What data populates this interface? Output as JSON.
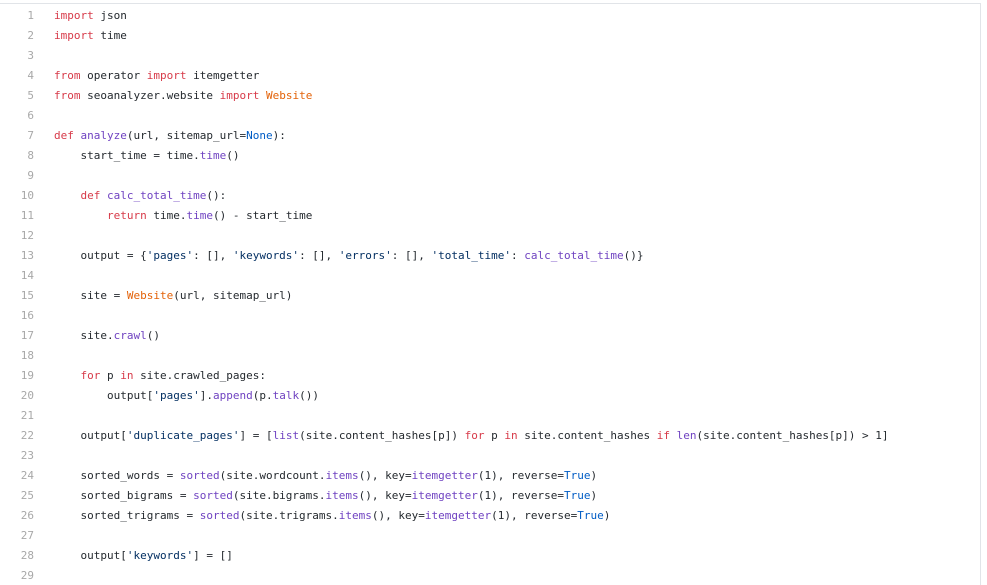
{
  "editor": {
    "lines": [
      {
        "number": "1",
        "tokens": [
          {
            "t": "import",
            "c": "kw"
          },
          {
            "t": " json",
            "c": "plain"
          }
        ]
      },
      {
        "number": "2",
        "tokens": [
          {
            "t": "import",
            "c": "kw"
          },
          {
            "t": " time",
            "c": "plain"
          }
        ]
      },
      {
        "number": "3",
        "tokens": []
      },
      {
        "number": "4",
        "tokens": [
          {
            "t": "from",
            "c": "kw"
          },
          {
            "t": " operator ",
            "c": "plain"
          },
          {
            "t": "import",
            "c": "kw"
          },
          {
            "t": " itemgetter",
            "c": "plain"
          }
        ]
      },
      {
        "number": "5",
        "tokens": [
          {
            "t": "from",
            "c": "kw"
          },
          {
            "t": " seoanalyzer.website ",
            "c": "plain"
          },
          {
            "t": "import",
            "c": "kw"
          },
          {
            "t": " ",
            "c": "plain"
          },
          {
            "t": "Website",
            "c": "cls"
          }
        ]
      },
      {
        "number": "6",
        "tokens": []
      },
      {
        "number": "7",
        "tokens": [
          {
            "t": "def",
            "c": "kw"
          },
          {
            "t": " ",
            "c": "plain"
          },
          {
            "t": "analyze",
            "c": "fn"
          },
          {
            "t": "(url, sitemap_url=",
            "c": "plain"
          },
          {
            "t": "None",
            "c": "const"
          },
          {
            "t": "):",
            "c": "plain"
          }
        ]
      },
      {
        "number": "8",
        "tokens": [
          {
            "t": "    start_time = time.",
            "c": "plain"
          },
          {
            "t": "time",
            "c": "fn"
          },
          {
            "t": "()",
            "c": "plain"
          }
        ]
      },
      {
        "number": "9",
        "tokens": []
      },
      {
        "number": "10",
        "tokens": [
          {
            "t": "    ",
            "c": "plain"
          },
          {
            "t": "def",
            "c": "kw"
          },
          {
            "t": " ",
            "c": "plain"
          },
          {
            "t": "calc_total_time",
            "c": "fn"
          },
          {
            "t": "():",
            "c": "plain"
          }
        ]
      },
      {
        "number": "11",
        "tokens": [
          {
            "t": "        ",
            "c": "plain"
          },
          {
            "t": "return",
            "c": "kw"
          },
          {
            "t": " time.",
            "c": "plain"
          },
          {
            "t": "time",
            "c": "fn"
          },
          {
            "t": "() - start_time",
            "c": "plain"
          }
        ]
      },
      {
        "number": "12",
        "tokens": []
      },
      {
        "number": "13",
        "tokens": [
          {
            "t": "    output = {",
            "c": "plain"
          },
          {
            "t": "'pages'",
            "c": "str"
          },
          {
            "t": ": [], ",
            "c": "plain"
          },
          {
            "t": "'keywords'",
            "c": "str"
          },
          {
            "t": ": [], ",
            "c": "plain"
          },
          {
            "t": "'errors'",
            "c": "str"
          },
          {
            "t": ": [], ",
            "c": "plain"
          },
          {
            "t": "'total_time'",
            "c": "str"
          },
          {
            "t": ": ",
            "c": "plain"
          },
          {
            "t": "calc_total_time",
            "c": "fn"
          },
          {
            "t": "()}",
            "c": "plain"
          }
        ]
      },
      {
        "number": "14",
        "tokens": []
      },
      {
        "number": "15",
        "tokens": [
          {
            "t": "    site = ",
            "c": "plain"
          },
          {
            "t": "Website",
            "c": "cls"
          },
          {
            "t": "(url, sitemap_url)",
            "c": "plain"
          }
        ]
      },
      {
        "number": "16",
        "tokens": []
      },
      {
        "number": "17",
        "tokens": [
          {
            "t": "    site.",
            "c": "plain"
          },
          {
            "t": "crawl",
            "c": "fn"
          },
          {
            "t": "()",
            "c": "plain"
          }
        ]
      },
      {
        "number": "18",
        "tokens": []
      },
      {
        "number": "19",
        "tokens": [
          {
            "t": "    ",
            "c": "plain"
          },
          {
            "t": "for",
            "c": "kw"
          },
          {
            "t": " p ",
            "c": "plain"
          },
          {
            "t": "in",
            "c": "kw"
          },
          {
            "t": " site.crawled_pages:",
            "c": "plain"
          }
        ]
      },
      {
        "number": "20",
        "tokens": [
          {
            "t": "        output[",
            "c": "plain"
          },
          {
            "t": "'pages'",
            "c": "str"
          },
          {
            "t": "].",
            "c": "plain"
          },
          {
            "t": "append",
            "c": "fn"
          },
          {
            "t": "(p.",
            "c": "plain"
          },
          {
            "t": "talk",
            "c": "fn"
          },
          {
            "t": "())",
            "c": "plain"
          }
        ]
      },
      {
        "number": "21",
        "tokens": []
      },
      {
        "number": "22",
        "tokens": [
          {
            "t": "    output[",
            "c": "plain"
          },
          {
            "t": "'duplicate_pages'",
            "c": "str"
          },
          {
            "t": "] = [",
            "c": "plain"
          },
          {
            "t": "list",
            "c": "fn"
          },
          {
            "t": "(site.content_hashes[p]) ",
            "c": "plain"
          },
          {
            "t": "for",
            "c": "kw"
          },
          {
            "t": " p ",
            "c": "plain"
          },
          {
            "t": "in",
            "c": "kw"
          },
          {
            "t": " site.content_hashes ",
            "c": "plain"
          },
          {
            "t": "if",
            "c": "kw"
          },
          {
            "t": " ",
            "c": "plain"
          },
          {
            "t": "len",
            "c": "fn"
          },
          {
            "t": "(site.content_hashes[p]) > 1]",
            "c": "plain"
          }
        ]
      },
      {
        "number": "23",
        "tokens": []
      },
      {
        "number": "24",
        "tokens": [
          {
            "t": "    sorted_words = ",
            "c": "plain"
          },
          {
            "t": "sorted",
            "c": "fn"
          },
          {
            "t": "(site.wordcount.",
            "c": "plain"
          },
          {
            "t": "items",
            "c": "fn"
          },
          {
            "t": "(), key=",
            "c": "plain"
          },
          {
            "t": "itemgetter",
            "c": "fn"
          },
          {
            "t": "(1), reverse=",
            "c": "plain"
          },
          {
            "t": "True",
            "c": "const"
          },
          {
            "t": ")",
            "c": "plain"
          }
        ]
      },
      {
        "number": "25",
        "tokens": [
          {
            "t": "    sorted_bigrams = ",
            "c": "plain"
          },
          {
            "t": "sorted",
            "c": "fn"
          },
          {
            "t": "(site.bigrams.",
            "c": "plain"
          },
          {
            "t": "items",
            "c": "fn"
          },
          {
            "t": "(), key=",
            "c": "plain"
          },
          {
            "t": "itemgetter",
            "c": "fn"
          },
          {
            "t": "(1), reverse=",
            "c": "plain"
          },
          {
            "t": "True",
            "c": "const"
          },
          {
            "t": ")",
            "c": "plain"
          }
        ]
      },
      {
        "number": "26",
        "tokens": [
          {
            "t": "    sorted_trigrams = ",
            "c": "plain"
          },
          {
            "t": "sorted",
            "c": "fn"
          },
          {
            "t": "(site.trigrams.",
            "c": "plain"
          },
          {
            "t": "items",
            "c": "fn"
          },
          {
            "t": "(), key=",
            "c": "plain"
          },
          {
            "t": "itemgetter",
            "c": "fn"
          },
          {
            "t": "(1), reverse=",
            "c": "plain"
          },
          {
            "t": "True",
            "c": "const"
          },
          {
            "t": ")",
            "c": "plain"
          }
        ]
      },
      {
        "number": "27",
        "tokens": []
      },
      {
        "number": "28",
        "tokens": [
          {
            "t": "    output[",
            "c": "plain"
          },
          {
            "t": "'keywords'",
            "c": "str"
          },
          {
            "t": "] = []",
            "c": "plain"
          }
        ]
      },
      {
        "number": "29",
        "tokens": []
      }
    ]
  },
  "colors": {
    "keyword": "#d73a49",
    "function": "#6f42c1",
    "class": "#e36209",
    "string": "#032f62",
    "constant": "#005cc5",
    "text": "#24292e",
    "line_number": "#a8a8a8"
  }
}
